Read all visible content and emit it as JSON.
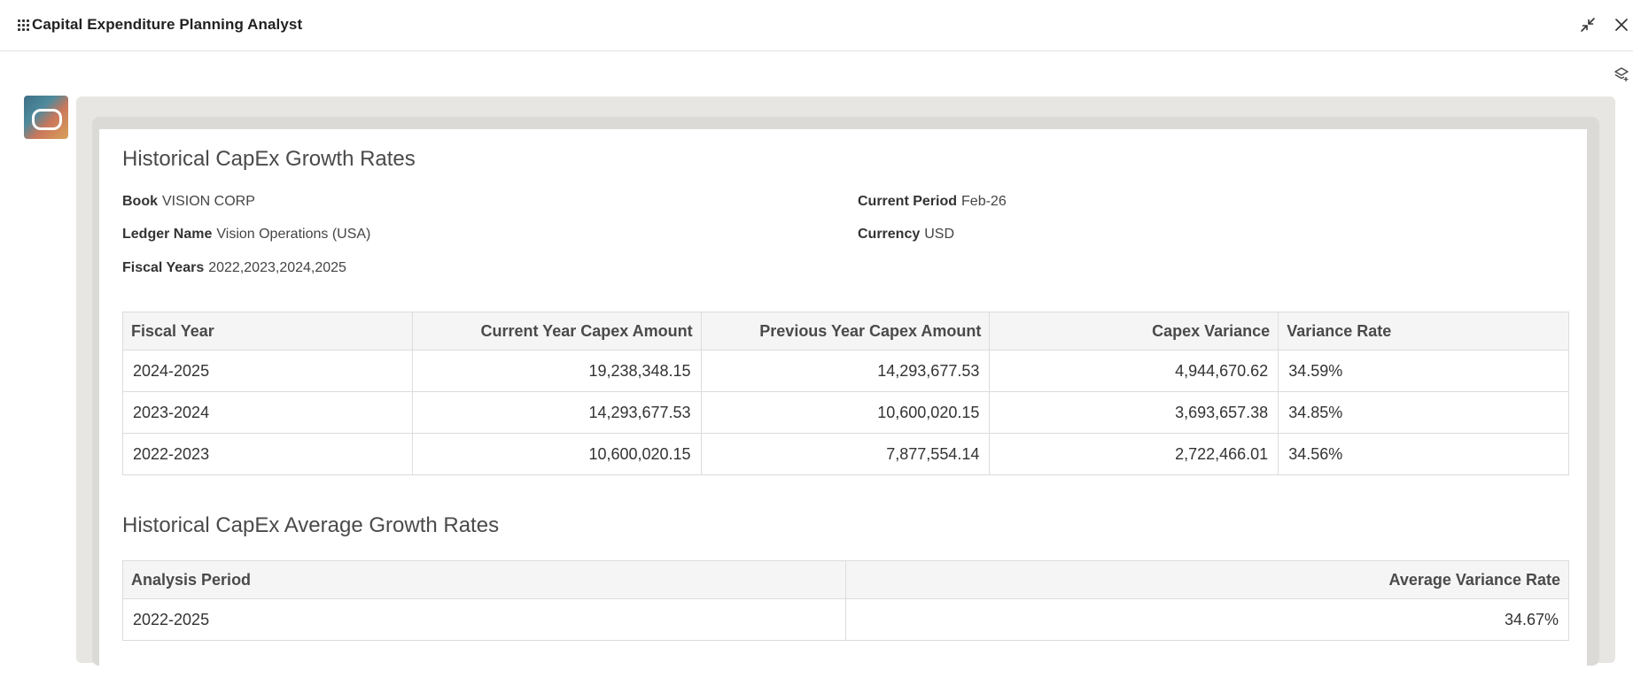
{
  "app": {
    "title": "Capital Expenditure Planning Analyst"
  },
  "icons": {
    "apps": "grid-dots-icon",
    "minimize": "collapse-icon",
    "close": "close-icon",
    "layers": "layers-icon",
    "avatar": "oracle-logo-icon"
  },
  "growth": {
    "title": "Historical CapEx Growth Rates",
    "book_label": "Book",
    "book_value": "VISION CORP",
    "ledger_label": "Ledger Name",
    "ledger_value": "Vision Operations (USA)",
    "fiscal_years_label": "Fiscal Years",
    "fiscal_years_value": "2022,2023,2024,2025",
    "current_period_label": "Current Period",
    "current_period_value": "Feb-26",
    "currency_label": "Currency",
    "currency_value": "USD",
    "columns": [
      "Fiscal Year",
      "Current Year Capex Amount",
      "Previous Year Capex Amount",
      "Capex Variance",
      "Variance Rate"
    ],
    "rows": [
      [
        "2024-2025",
        "19,238,348.15",
        "14,293,677.53",
        "4,944,670.62",
        "34.59%"
      ],
      [
        "2023-2024",
        "14,293,677.53",
        "10,600,020.15",
        "3,693,657.38",
        "34.85%"
      ],
      [
        "2022-2023",
        "10,600,020.15",
        "7,877,554.14",
        "2,722,466.01",
        "34.56%"
      ]
    ]
  },
  "average": {
    "title": "Historical CapEx Average Growth Rates",
    "columns": [
      "Analysis Period",
      "Average Variance Rate"
    ],
    "rows": [
      [
        "2022-2025",
        "34.67%"
      ]
    ]
  }
}
